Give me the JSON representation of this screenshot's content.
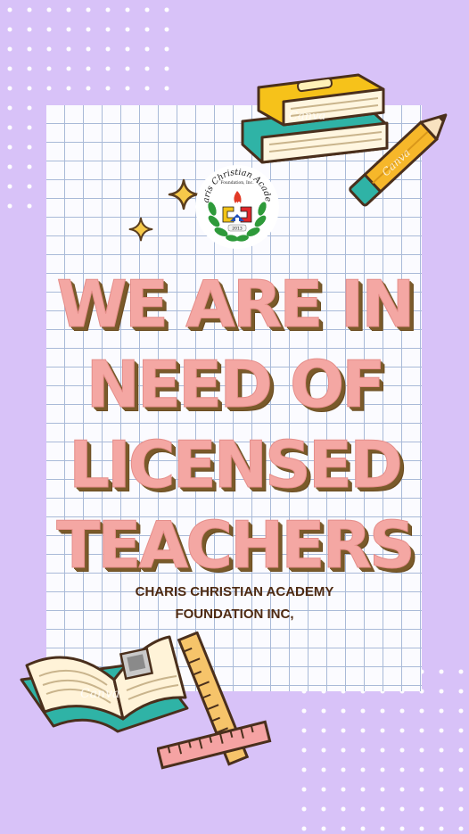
{
  "poster": {
    "headline_lines": [
      "WE ARE IN",
      "NEED OF",
      "LICENSED",
      "TEACHERS"
    ],
    "organization_lines": [
      "CHARIS CHRISTIAN ACADEMY",
      "FOUNDATION INC,"
    ]
  },
  "logo": {
    "name_arc": "Charis Christian Academy",
    "sub_arc": "Foundation, Inc.",
    "year": "2013"
  },
  "watermarks": [
    "Canva",
    "Canva",
    "Canva"
  ],
  "colors": {
    "background": "#d8c2f8",
    "paper": "#fbfbff",
    "grid": "#a9bad8",
    "headline": "#f4a7a3",
    "headline_shadow": "#7a5a2a",
    "organization_text": "#4e2a12"
  },
  "icons": [
    "stacked-books-icon",
    "pencil-icon",
    "sparkle-icon",
    "open-book-icon",
    "ruler-icon",
    "school-logo"
  ]
}
